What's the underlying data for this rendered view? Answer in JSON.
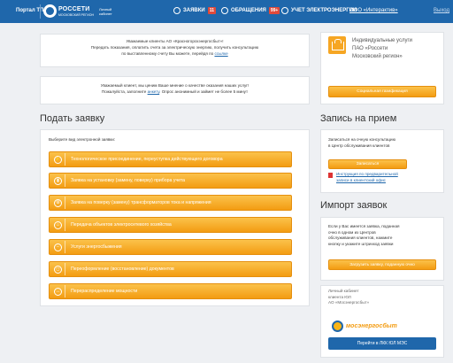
{
  "header": {
    "portal": "Портал ТП",
    "brand": "РОССЕТИ",
    "brand_sub": "МОСКОВСКИЙ РЕГИОН",
    "lk": "Личный кабинет",
    "nav": [
      {
        "label": "ЗАЯВКИ",
        "badge": "11"
      },
      {
        "label": "ОБРАЩЕНИЯ",
        "badge": "99+"
      },
      {
        "label": "УЧЕТ ЭЛЕКТРОЭНЕРГИИ",
        "badge": ""
      }
    ],
    "org": "ООО «Интерактив»",
    "exit": "Выход"
  },
  "notice1": {
    "line1": "Уважаемые клиенты АО «Красногорскэнергосбыт»!",
    "line2": "Передать показания, оплатить счета за электрическую энергию, получить консультацию",
    "line3": "по выставленному счету Вы можете, перейдя по",
    "link": "ссылке"
  },
  "notice2": {
    "line1": "Уважаемый клиент, мы ценим Ваше мнение о качестве оказания наших услуг!",
    "line2": "Пожалуйста, заполните",
    "link": "анкету",
    "line2_end": ". Опрос анонимный и займет не более 5 минут"
  },
  "services": {
    "text1": "Индивидуальные услуги",
    "text2": "ПАО «Россети",
    "text3": "Московский регион»",
    "button": "Социальная газификация"
  },
  "submit": {
    "title": "Подать заявку",
    "choose": "Выберите вид электронной заявки:",
    "buttons": [
      {
        "label": "Технологическое присоединение, переуступка действующего договора",
        "icon": "⚡"
      },
      {
        "label": "Заявка на установку (замену, поверку) прибора учета",
        "icon": "▮"
      },
      {
        "label": "Заявка на поверку (замену) трансформаторов тока и напряжения",
        "icon": "⚙"
      },
      {
        "label": "Передача объектов электросетевого хозяйства",
        "icon": "⌂"
      },
      {
        "label": "Услуги энергосбыжения",
        "icon": "−"
      },
      {
        "label": "Переоформление (восстановление) документов",
        "icon": "◻"
      },
      {
        "label": "Перераспределение мощности",
        "icon": "↔"
      }
    ]
  },
  "appointment": {
    "title": "Запись на прием",
    "text1": "Записаться на очную консультацию",
    "text2": "в Центр обслуживания клиентов",
    "button": "Записаться",
    "instr1": "Инструкция по предварительной",
    "instr2": "записи в клиентский офис"
  },
  "import": {
    "title": "Импорт заявок",
    "text1": "Если у Вас имеется заявка, поданная",
    "text2": "очно в одном из Центров",
    "text3": "обслуживания клиентов, нажмите",
    "text4": "кнопку и укажите штрихкод заявки",
    "button": "Загрузить заявку, поданную очно"
  },
  "mes": {
    "text1": "Личный кабинет",
    "text2": "клиента ЮЛ",
    "text3": "АО «Мосэнергосбыт»",
    "logo_a": "мос",
    "logo_b": "энергосбыт",
    "button": "Перейти в ЛКК ЮЛ МЭС"
  },
  "colors": {
    "header": "#1f67ab",
    "accent": "#f39c12"
  }
}
